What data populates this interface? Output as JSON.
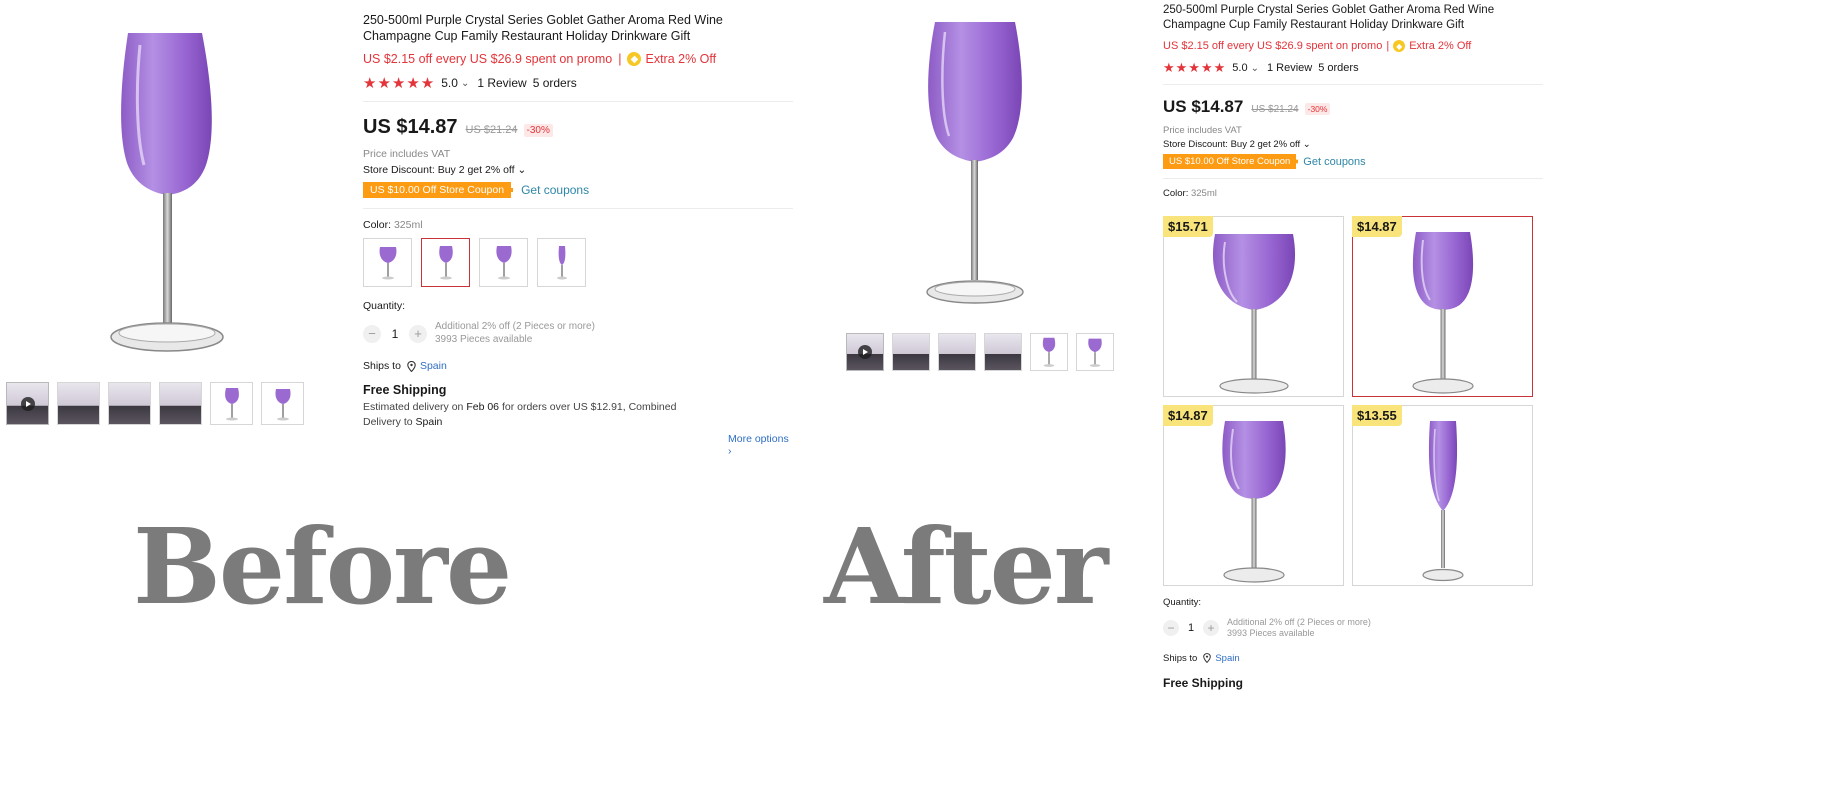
{
  "product": {
    "title": "250-500ml Purple Crystal Series Goblet Gather Aroma Red Wine Champagne Cup Family Restaurant Holiday Drinkware Gift",
    "promo_text": "US $2.15 off every US $26.9 spent on promo",
    "promo_sep": "|",
    "extra_off": "Extra 2% Off",
    "stars": "★★★★★",
    "rating": "5.0",
    "reviews": "1 Review",
    "orders": "5 orders",
    "price": "US $14.87",
    "old_price": "US $21.24",
    "discount_badge": "-30%",
    "vat": "Price includes VAT",
    "store_discount": "Store Discount: Buy 2 get 2% off",
    "coupon_tag": "US $10.00 Off Store Coupon",
    "get_coupons": "Get coupons",
    "color_label": "Color:",
    "color_value": "325ml",
    "quantity_label": "Quantity:",
    "qty_minus": "−",
    "qty_value": "1",
    "qty_plus": "+",
    "qty_additional": "Additional 2% off (2 Pieces or more)",
    "qty_available": "3993 Pieces available",
    "ships_to_label": "Ships to",
    "ships_to_country": "Spain",
    "free_shipping": "Free Shipping",
    "estimate_prefix": "Estimated delivery on",
    "estimate_date": "Feb 06",
    "estimate_suffix": "for orders over US $12.91, Combined Delivery",
    "estimate_to": "to",
    "estimate_country": "Spain",
    "more_options": "More options ›",
    "chevron": "⌄"
  },
  "labels": {
    "before": "Before",
    "after": "After"
  },
  "after_variants": [
    {
      "price": "$15.71",
      "shape": "balloon"
    },
    {
      "price": "$14.87",
      "shape": "tulip"
    },
    {
      "price": "$14.87",
      "shape": "bordeaux"
    },
    {
      "price": "$13.55",
      "shape": "flute"
    }
  ],
  "colors": {
    "accent_red": "#e3343a",
    "coupon_orange": "#fd9b13",
    "link_blue": "#2e6ec4",
    "price_tag_yellow": "#f8e47a",
    "glass_purple": "#9b6ad1",
    "label_gray": "#7b7b7b"
  },
  "icons": [
    "play-icon",
    "pin-icon",
    "coin-icon",
    "star-icon",
    "chevron-down-icon"
  ]
}
